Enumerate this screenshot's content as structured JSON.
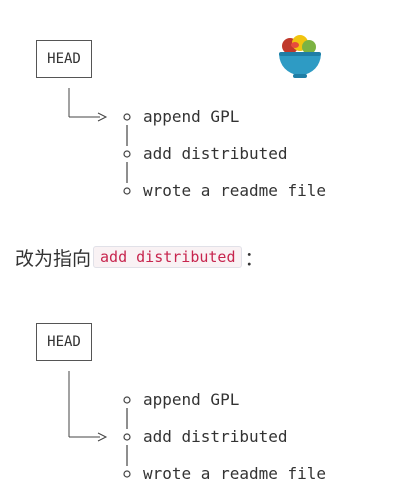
{
  "diagram1": {
    "head_label": "HEAD",
    "commits": [
      "append GPL",
      "add distributed",
      "wrote a readme file"
    ],
    "head_points_to": 0
  },
  "caption": {
    "prefix": "改为指向",
    "code": "add distributed",
    "suffix": "："
  },
  "diagram2": {
    "head_label": "HEAD",
    "commits": [
      "append GPL",
      "add distributed",
      "wrote a readme file"
    ],
    "head_points_to": 1
  },
  "logo": {
    "icon": "salad-bowl-icon"
  }
}
